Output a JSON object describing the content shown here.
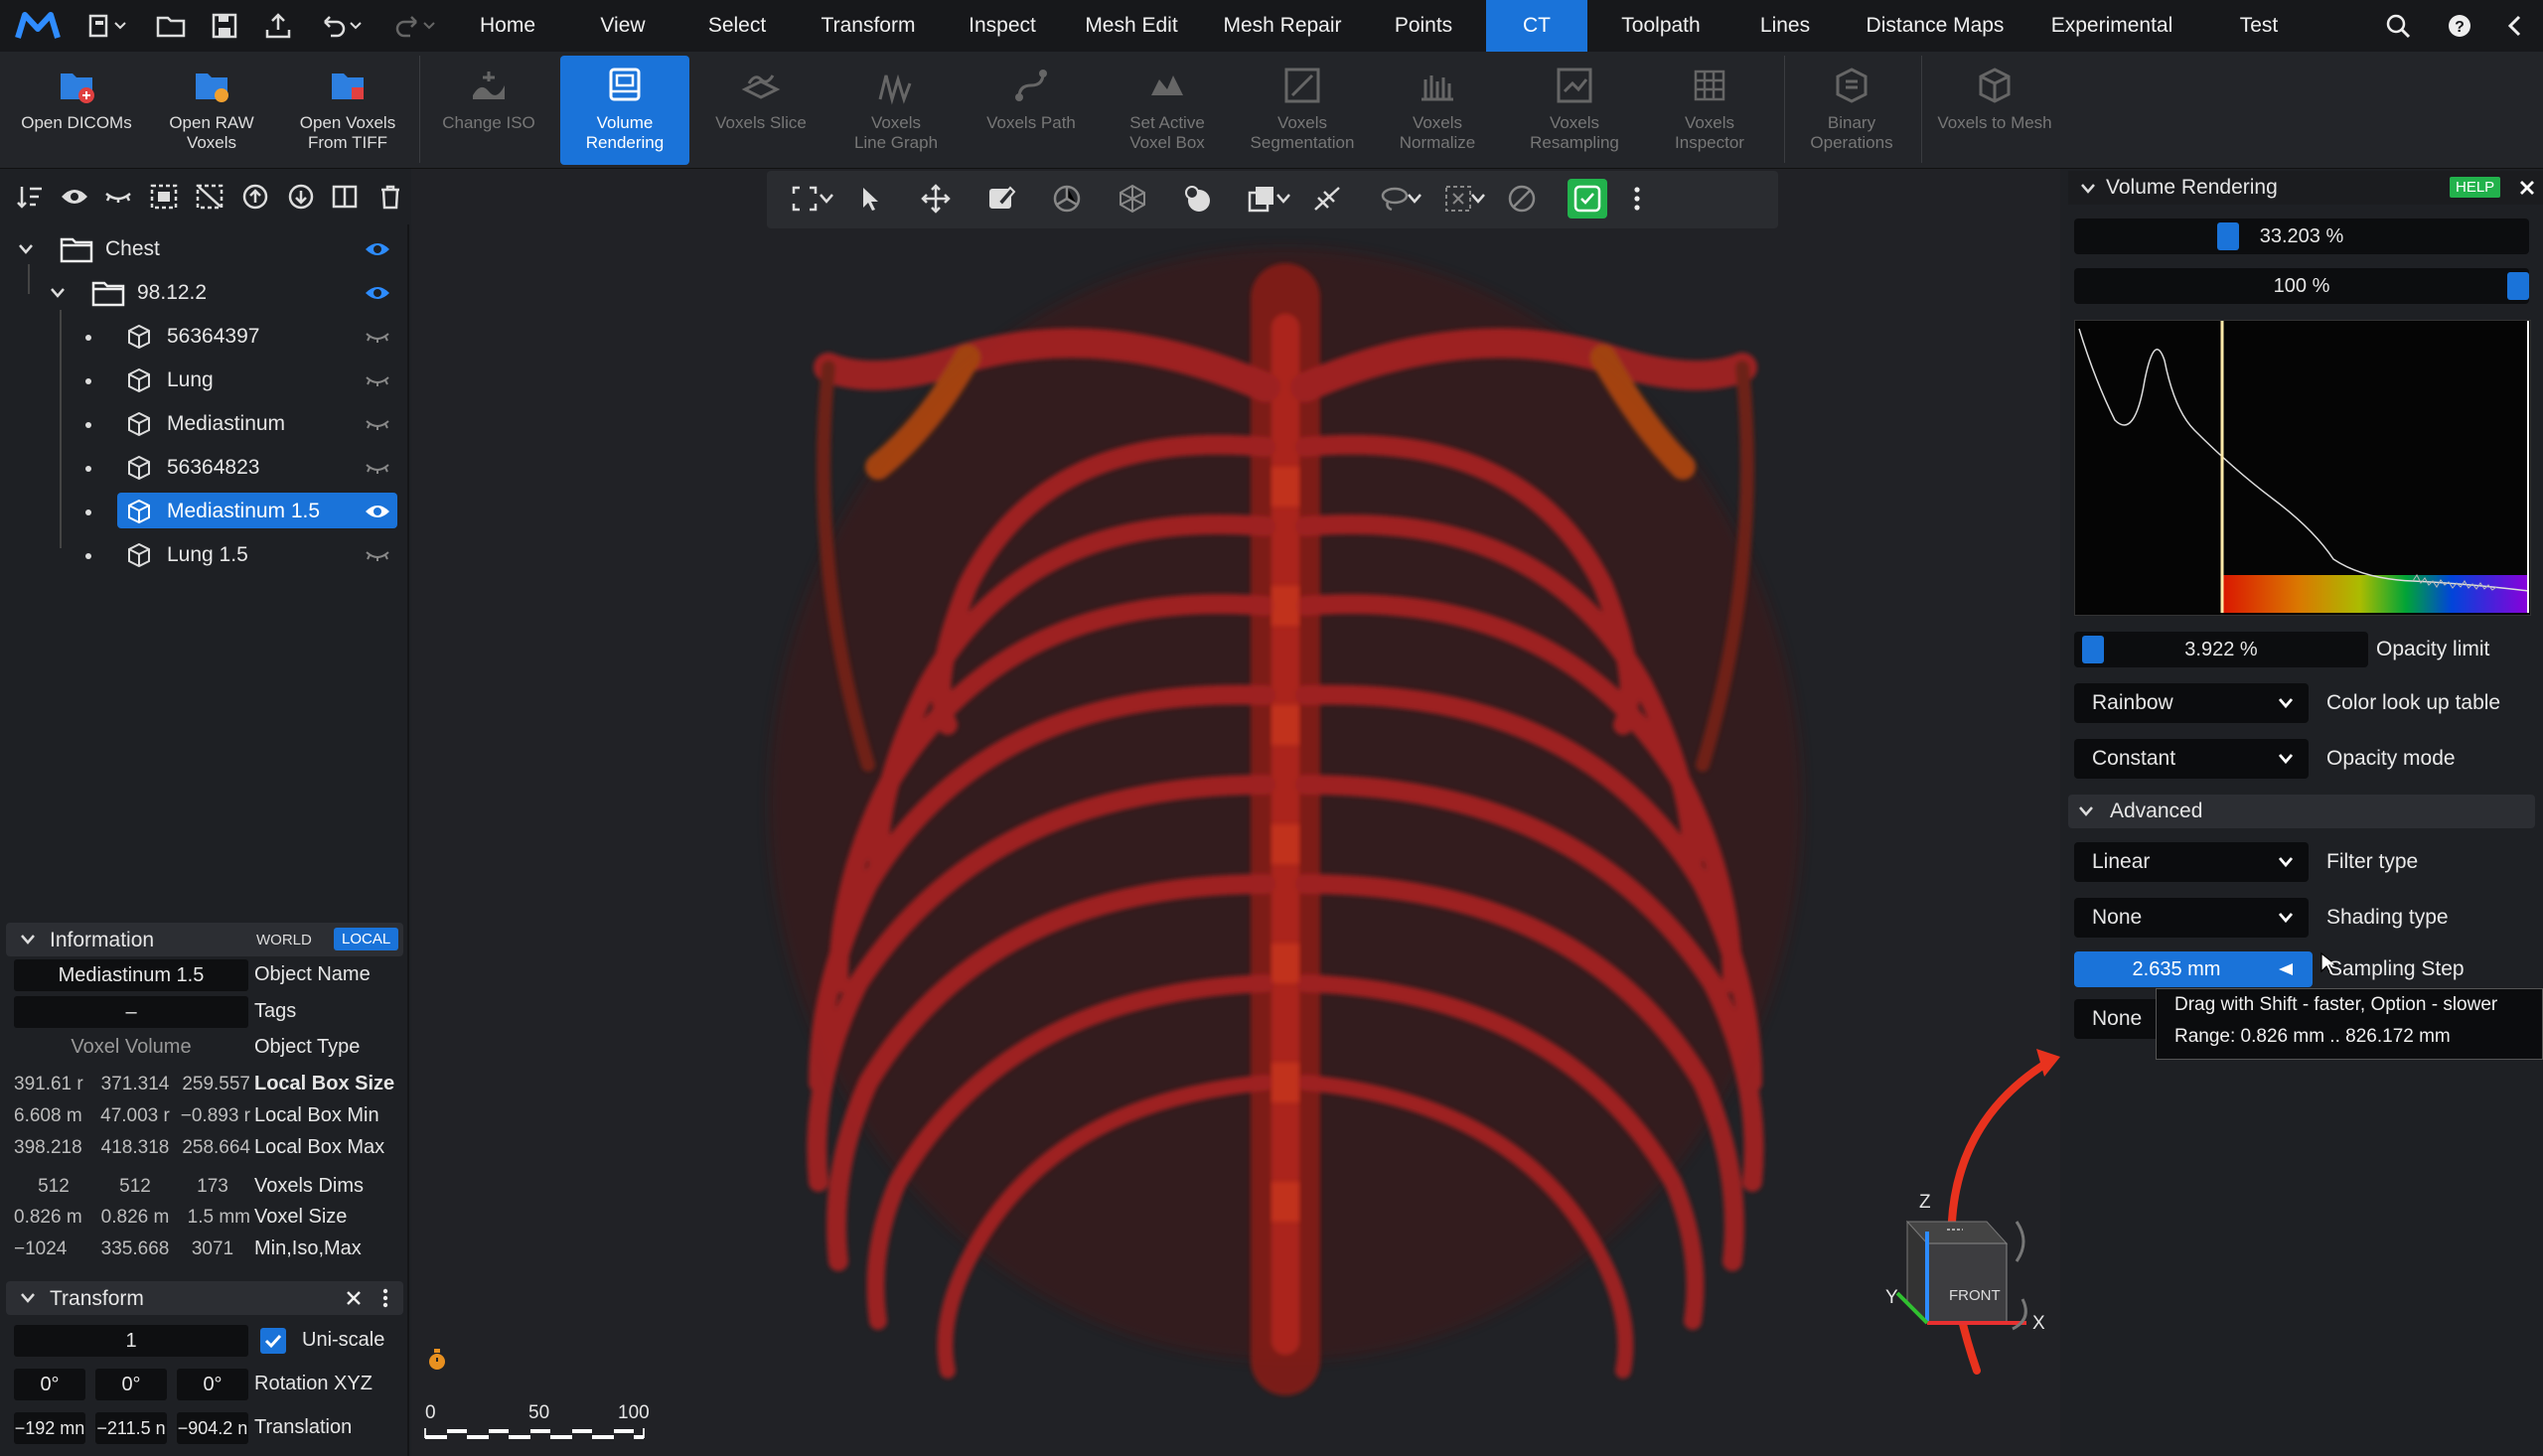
{
  "menubar": {
    "items": [
      "Home",
      "View",
      "Select",
      "Transform",
      "Inspect",
      "Mesh Edit",
      "Mesh Repair",
      "Points",
      "CT",
      "Toolpath",
      "Lines",
      "Distance Maps",
      "Experimental",
      "Test"
    ],
    "active": "CT"
  },
  "ribbon": {
    "buttons": [
      {
        "label1": "Open DICOMs",
        "label2": "",
        "icon": "open-dicoms-icon"
      },
      {
        "label1": "Open RAW",
        "label2": "Voxels",
        "icon": "open-raw-voxels-icon"
      },
      {
        "label1": "Open Voxels",
        "label2": "From TIFF",
        "icon": "open-tiff-icon"
      },
      {
        "label1": "Change ISO",
        "label2": "",
        "icon": "change-iso-icon"
      },
      {
        "label1": "Volume",
        "label2": "Rendering",
        "icon": "volume-rendering-icon"
      },
      {
        "label1": "Voxels Slice",
        "label2": "",
        "icon": "voxels-slice-icon"
      },
      {
        "label1": "Voxels",
        "label2": "Line Graph",
        "icon": "line-graph-icon"
      },
      {
        "label1": "Voxels Path",
        "label2": "",
        "icon": "voxels-path-icon"
      },
      {
        "label1": "Set Active",
        "label2": "Voxel Box",
        "icon": "voxel-box-icon"
      },
      {
        "label1": "Voxels",
        "label2": "Segmentation",
        "icon": "segmentation-icon"
      },
      {
        "label1": "Voxels",
        "label2": "Normalize",
        "icon": "normalize-icon"
      },
      {
        "label1": "Voxels",
        "label2": "Resampling",
        "icon": "resampling-icon"
      },
      {
        "label1": "Voxels",
        "label2": "Inspector",
        "icon": "inspector-icon"
      },
      {
        "label1": "Binary",
        "label2": "Operations",
        "icon": "binary-ops-icon"
      },
      {
        "label1": "Voxels to Mesh",
        "label2": "",
        "icon": "voxels-to-mesh-icon"
      }
    ]
  },
  "tree": {
    "root": "Chest",
    "folder": "98.12.2",
    "items": [
      "56364397",
      "Lung",
      "Mediastinum",
      "56364823",
      "Mediastinum 1.5",
      "Lung 1.5"
    ],
    "selected": "Mediastinum 1.5"
  },
  "information": {
    "title": "Information",
    "world": "WORLD",
    "local": "LOCAL",
    "object_name_value": "Mediastinum 1.5",
    "object_name_label": "Object Name",
    "tags_value": "–",
    "tags_label": "Tags",
    "object_type_value": "Voxel Volume",
    "object_type_label": "Object Type",
    "rows": [
      {
        "label": "Local Box Size",
        "v": [
          "391.61 r",
          "371.314",
          "259.557"
        ]
      },
      {
        "label": "Local Box Min",
        "v": [
          "6.608 m",
          "47.003 r",
          "−0.893 r"
        ]
      },
      {
        "label": "Local Box Max",
        "v": [
          "398.218",
          "418.318",
          "258.664"
        ]
      },
      {
        "label": "Voxels Dims",
        "v": [
          "512",
          "512",
          "173"
        ]
      },
      {
        "label": "Voxel Size",
        "v": [
          "0.826 m",
          "0.826 m",
          "1.5 mm"
        ]
      },
      {
        "label": "Min,Iso,Max",
        "v": [
          "−1024",
          "335.668",
          "3071"
        ]
      }
    ]
  },
  "transform": {
    "title": "Transform",
    "scale": "1",
    "uniscale_label": "Uni-scale",
    "rotation": [
      "0°",
      "0°",
      "0°"
    ],
    "rotation_label": "Rotation XYZ",
    "translation": [
      "−192 mn",
      "−211.5 n",
      "−904.2 n"
    ],
    "translation_label": "Translation"
  },
  "scale_bar": {
    "ticks": [
      "0",
      "50",
      "100"
    ]
  },
  "volume_rendering": {
    "title": "Volume Rendering",
    "help": "HELP",
    "slider1": "33.203 %",
    "slider1_level": 33.203,
    "slider2": "100 %",
    "slider2_level": 100,
    "opacity_limit_value": "3.922 %",
    "opacity_limit_label": "Opacity limit",
    "color_lut_value": "Rainbow",
    "color_lut_label": "Color look up table",
    "opacity_mode_value": "Constant",
    "opacity_mode_label": "Opacity mode",
    "advanced_label": "Advanced",
    "filter_type_value": "Linear",
    "filter_type_label": "Filter type",
    "shading_type_value": "None",
    "shading_type_label": "Shading type",
    "sampling_step_value": "2.635 mm",
    "sampling_step_label": "Sampling Step",
    "last_dd_value": "None",
    "tooltip_line1": "Drag with Shift - faster, Option - slower",
    "tooltip_line2": "Range: 0.826 mm .. 826.172 mm"
  },
  "viewcube": {
    "face": "FRONT",
    "x": "X",
    "y": "Y",
    "z": "Z"
  },
  "colors": {
    "accent": "#1a73d9",
    "arrow": "#e8321e",
    "green": "#22b24c"
  }
}
